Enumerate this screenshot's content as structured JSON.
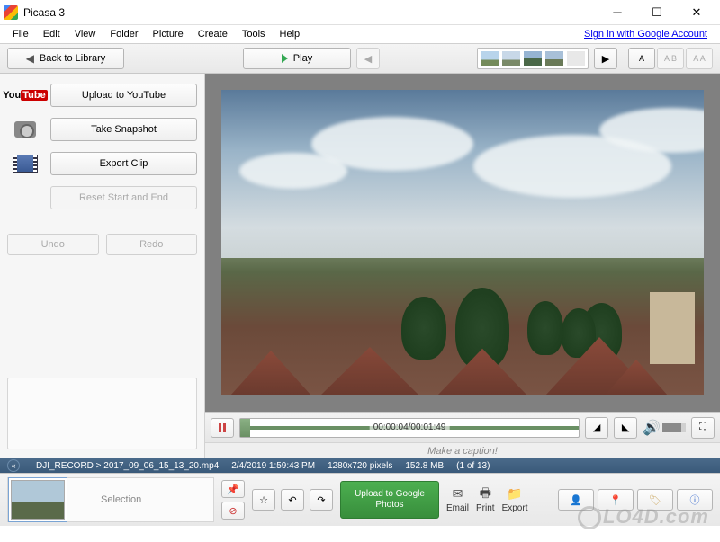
{
  "titlebar": {
    "title": "Picasa 3"
  },
  "menu": {
    "items": [
      "File",
      "Edit",
      "View",
      "Folder",
      "Picture",
      "Create",
      "Tools",
      "Help"
    ],
    "signin": "Sign in with Google Account"
  },
  "toolbar": {
    "back": "Back to Library",
    "play": "Play",
    "text_sizes": [
      "A",
      "A B",
      "A A"
    ]
  },
  "sidebar": {
    "upload_yt": "Upload to YouTube",
    "snapshot": "Take Snapshot",
    "export_clip": "Export Clip",
    "reset": "Reset Start and End",
    "undo": "Undo",
    "redo": "Redo"
  },
  "playback": {
    "time": "00:00:04/00:01:49"
  },
  "caption": {
    "placeholder": "Make a caption!"
  },
  "infobar": {
    "path": "DJI_RECORD > 2017_09_06_15_13_20.mp4",
    "datetime": "2/4/2019 1:59:43 PM",
    "dimensions": "1280x720 pixels",
    "size": "152.8 MB",
    "position": "(1 of 13)"
  },
  "tray": {
    "selection": "Selection",
    "upload": "Upload to Google Photos",
    "email": "Email",
    "print": "Print",
    "export": "Export"
  },
  "watermark": "LO4D.com"
}
